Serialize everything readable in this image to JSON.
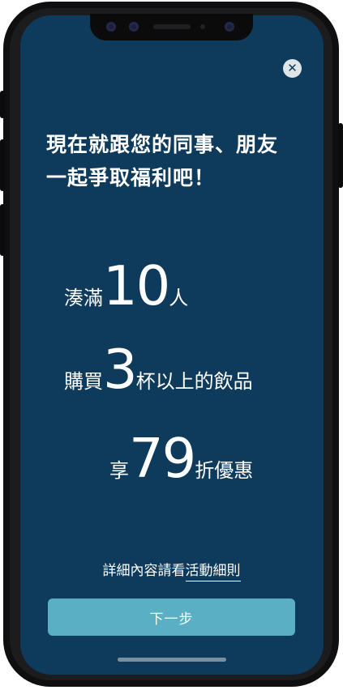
{
  "modal": {
    "close_icon": "close-icon",
    "headline_line1": "現在就跟您的同事、朋友",
    "headline_line2": "一起爭取福利吧！"
  },
  "conditions": {
    "row1": {
      "prefix": "湊滿",
      "number": "10",
      "suffix": "人"
    },
    "row2": {
      "prefix": "購買",
      "number": "3",
      "suffix": "杯以上的飲品"
    },
    "row3": {
      "prefix": "享",
      "number": "79",
      "suffix": "折優惠"
    }
  },
  "footer": {
    "rules_text": "詳細內容請看",
    "rules_link": "活動細則",
    "next_button": "下一步"
  },
  "colors": {
    "background": "#0e3a5c",
    "button": "#5aafc5",
    "text": "#ffffff"
  }
}
